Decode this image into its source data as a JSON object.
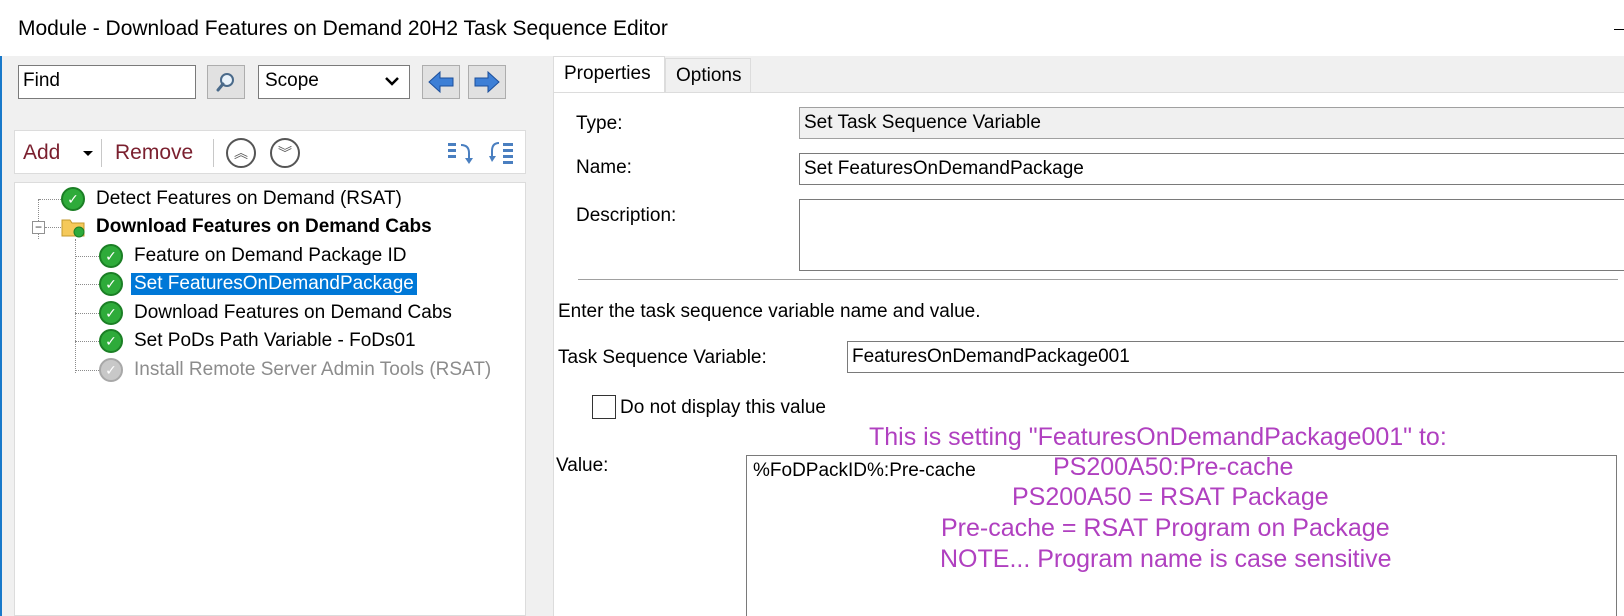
{
  "window": {
    "title": "Module - Download Features on Demand 20H2 Task Sequence Editor"
  },
  "search": {
    "find_value": "Find",
    "scope_value": "Scope"
  },
  "toolbar": {
    "add_label": "Add",
    "remove_label": "Remove"
  },
  "tree": {
    "items": [
      {
        "label": "Detect Features on Demand (RSAT)",
        "status": "success"
      },
      {
        "label": "Download Features on Demand Cabs",
        "status": "group"
      },
      {
        "label": "Feature on Demand Package ID",
        "status": "success"
      },
      {
        "label": "Set FeaturesOnDemandPackage",
        "status": "success"
      },
      {
        "label": "Download Features on Demand Cabs",
        "status": "success"
      },
      {
        "label": "Set PoDs Path Variable - FoDs01",
        "status": "success"
      },
      {
        "label": "Install Remote Server Admin Tools (RSAT)",
        "status": "disabled"
      }
    ]
  },
  "tabs": {
    "properties": "Properties",
    "options": "Options"
  },
  "properties": {
    "type_label": "Type:",
    "type_value": "Set Task Sequence Variable",
    "name_label": "Name:",
    "name_value": "Set FeaturesOnDemandPackage",
    "description_label": "Description:",
    "description_value": "",
    "instruction": "Enter the task sequence variable name and value.",
    "variable_label": "Task Sequence Variable:",
    "variable_value": "FeaturesOnDemandPackage001",
    "hide_value_label": "Do not display this value",
    "hide_value_checked": false,
    "value_label": "Value:",
    "value_value": "%FoDPackID%:Pre-cache"
  },
  "annotation": {
    "line1": "This is setting \"FeaturesOnDemandPackage001\" to:",
    "line2": "PS200A50:Pre-cache",
    "line3": "PS200A50 = RSAT Package",
    "line4": "Pre-cache = RSAT Program on Package",
    "line5": "NOTE... Program name is case sensitive",
    "color": "#b040c0"
  },
  "colors": {
    "selection": "#0078d7",
    "status_ok": "#2eab3a",
    "toolbar_text": "#7a1f2e"
  }
}
